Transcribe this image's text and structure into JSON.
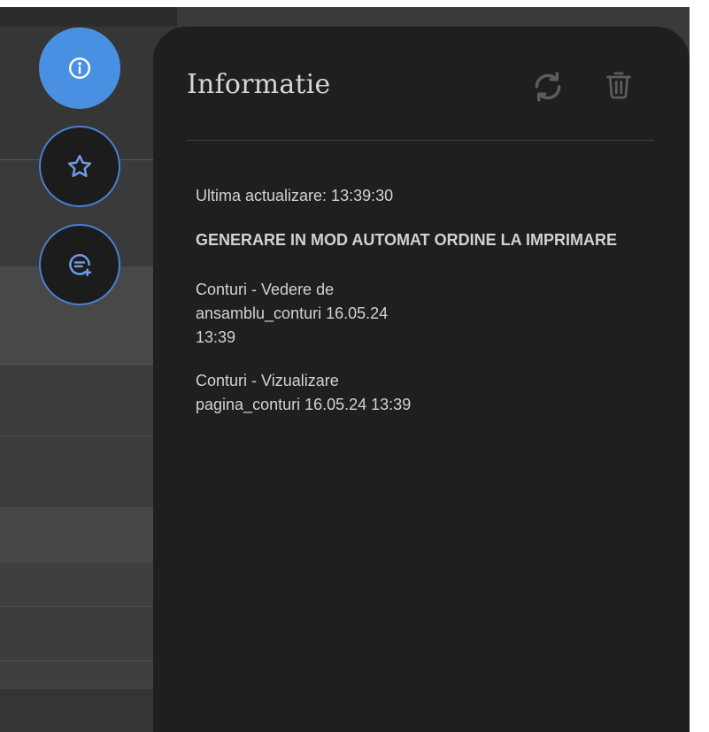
{
  "panel": {
    "title": "Informatie",
    "last_updated_label": "Ultima actualizare: 13:39:30",
    "heading": "GENERARE IN MOD AUTOMAT ORDINE LA IMPRIMARE",
    "items": [
      {
        "text": "Conturi - Vedere de\nansamblu_conturi 16.05.24\n13:39"
      },
      {
        "text": "Conturi - Vizualizare\npagina_conturi 16.05.24 13:39"
      }
    ]
  },
  "side_buttons": [
    {
      "name": "info",
      "icon": "info-icon"
    },
    {
      "name": "favorites",
      "icon": "star-icon"
    },
    {
      "name": "messages",
      "icon": "chat-add-icon"
    }
  ],
  "colors": {
    "accent": "#4a90e2",
    "panel_bg": "#1f1f1f",
    "text": "#d2d2d2"
  }
}
